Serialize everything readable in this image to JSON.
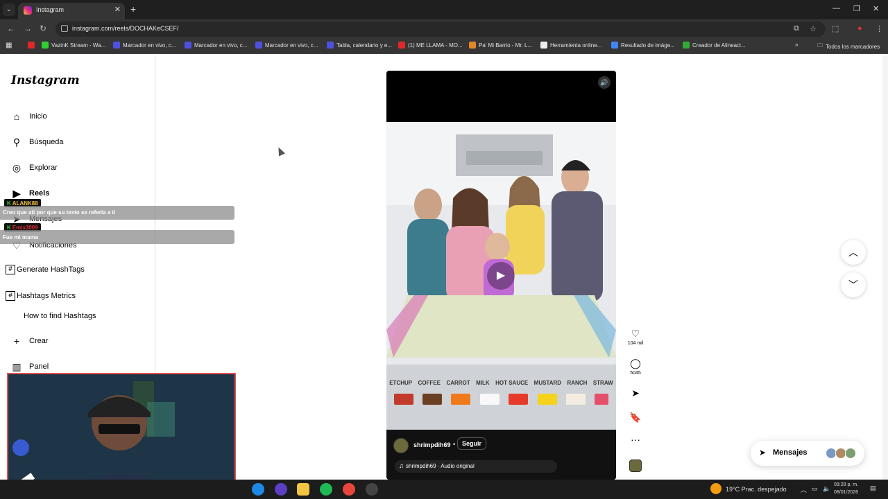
{
  "browser": {
    "tab_title": "Instagram",
    "url": "instagram.com/reels/DOCHAKeCSEF/",
    "bookmarks": [
      {
        "label": "",
        "color": "#e02828"
      },
      {
        "label": "VazinK Stream - Wa...",
        "color": "#33cc33"
      },
      {
        "label": "Marcador en vivo, c...",
        "color": "#5050e0"
      },
      {
        "label": "Marcador en vivo, c...",
        "color": "#5050e0"
      },
      {
        "label": "Marcador en vivo, c...",
        "color": "#5050e0"
      },
      {
        "label": "Tabla, calendario y e...",
        "color": "#5050e0"
      },
      {
        "label": "(1) ME LLAMA - MO...",
        "color": "#e02828"
      },
      {
        "label": "Pa' Mi Barrio - Mr. L...",
        "color": "#e08828"
      },
      {
        "label": "Herramienta online...",
        "color": "#eeeeee"
      },
      {
        "label": "Resultado de imáge...",
        "color": "#4285f4"
      },
      {
        "label": "Creador de Alineaci...",
        "color": "#33aa33"
      }
    ],
    "all_bookmarks_label": "Todos los marcadores"
  },
  "sidebar": {
    "logo": "Instagram",
    "items": [
      {
        "label": "Inicio",
        "icon": "home-icon"
      },
      {
        "label": "Búsqueda",
        "icon": "search-icon"
      },
      {
        "label": "Explorar",
        "icon": "compass-icon"
      },
      {
        "label": "Reels",
        "icon": "reels-icon"
      },
      {
        "label": "Mensajes",
        "icon": "messages-icon"
      },
      {
        "label": "Notificaciones",
        "icon": "heart-icon"
      }
    ],
    "hashtags_generate": "Generate HashTags",
    "hashtags_metrics": "Hashtags Metrics",
    "how_to_find": "How to find Hashtags",
    "create": "Crear",
    "panel": "Panel"
  },
  "chat": [
    {
      "user": "ALANK88",
      "message": "Creo que ati por que su texto se refería a ti",
      "user_color": "#f0c040"
    },
    {
      "user": "Emix3009",
      "message": "Fue mi mama",
      "user_color": "#e03030"
    }
  ],
  "reel": {
    "author": "shrimpdih69",
    "follow_label": "Seguir",
    "separator": "•",
    "audio": "shrimpdih69 · Audio original",
    "likes": "104 mil",
    "comments": "5045",
    "cup_labels": [
      "ETCHUP",
      "COFFEE",
      "CARROT",
      "MILK",
      "HOT SAUCE",
      "MUSTARD",
      "RANCH",
      "STRAW"
    ]
  },
  "messages_pill": {
    "label": "Mensajes"
  },
  "taskbar": {
    "weather": "19°C  Prac. despejado",
    "time": "09:28 p. m.",
    "date": "08/01/2026"
  }
}
